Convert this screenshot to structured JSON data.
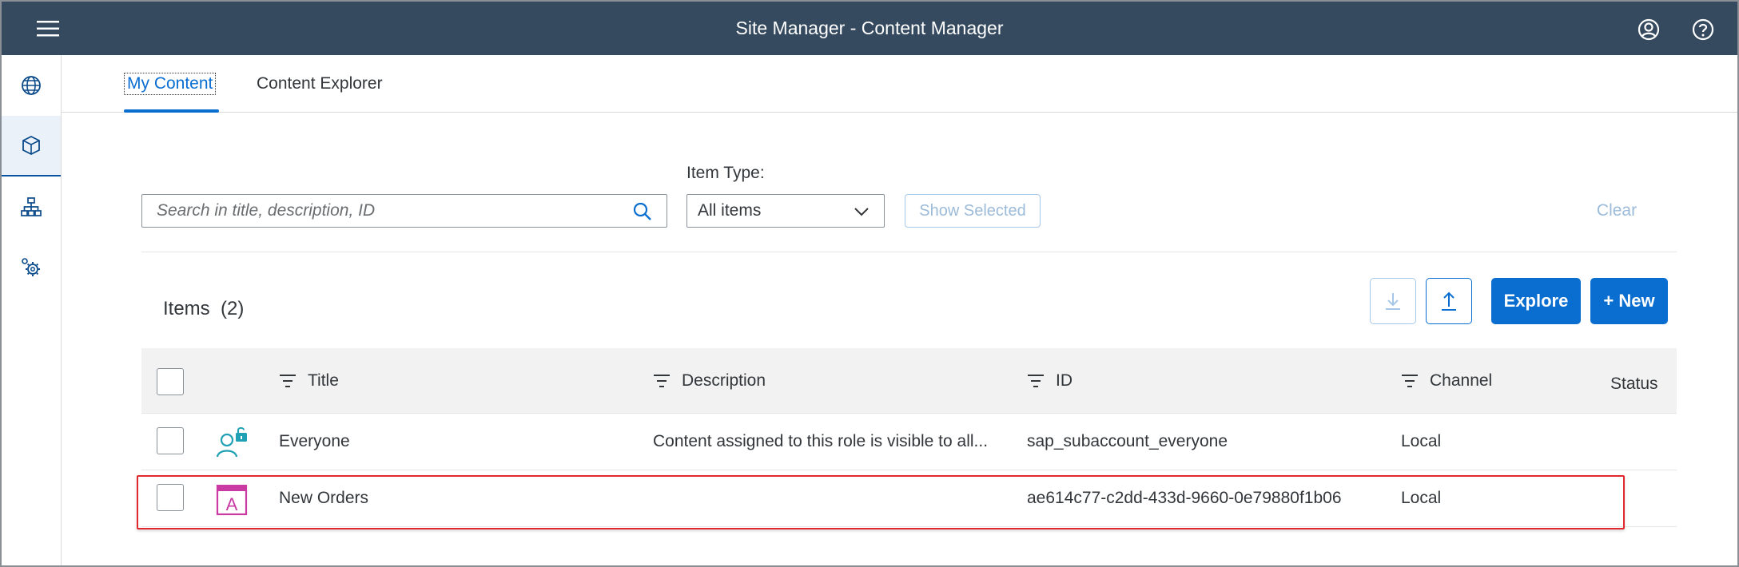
{
  "shell": {
    "title": "Site Manager - Content Manager",
    "icons": [
      "menu-icon",
      "user-icon",
      "help-icon"
    ]
  },
  "sidenav": {
    "items": [
      {
        "name": "globe-icon",
        "active": false
      },
      {
        "name": "cube-icon",
        "active": true
      },
      {
        "name": "hierarchy-icon",
        "active": false
      },
      {
        "name": "settings-icon",
        "active": false
      }
    ]
  },
  "tabs": [
    {
      "label": "My Content",
      "selected": true
    },
    {
      "label": "Content Explorer",
      "selected": false
    }
  ],
  "filter": {
    "search_placeholder": "Search in title, description, ID",
    "item_type_label": "Item Type:",
    "item_type_value": "All items",
    "show_selected_label": "Show Selected",
    "clear_label": "Clear"
  },
  "toolbar": {
    "items_title": "Items",
    "items_count": "(2)",
    "explore_label": "Explore",
    "new_label": "+ New"
  },
  "table": {
    "columns": [
      "Title",
      "Description",
      "ID",
      "Channel",
      "Status"
    ],
    "rows": [
      {
        "icon": "role-unlocked-icon",
        "title": "Everyone",
        "description": "Content assigned to this role is visible to all...",
        "id": "sap_subaccount_everyone",
        "channel": "Local",
        "status": ""
      },
      {
        "icon": "app-tile-icon",
        "title": "New Orders",
        "description": "",
        "id": "ae614c77-c2dd-433d-9660-0e79880f1b06",
        "channel": "Local",
        "status": "",
        "highlighted": true
      }
    ]
  },
  "colors": {
    "shell": "#354a5f",
    "accent": "#0a6ed1",
    "highlight": "#e0282e",
    "role_icon": "#1fa0b4",
    "app_icon": "#c93ba3"
  }
}
